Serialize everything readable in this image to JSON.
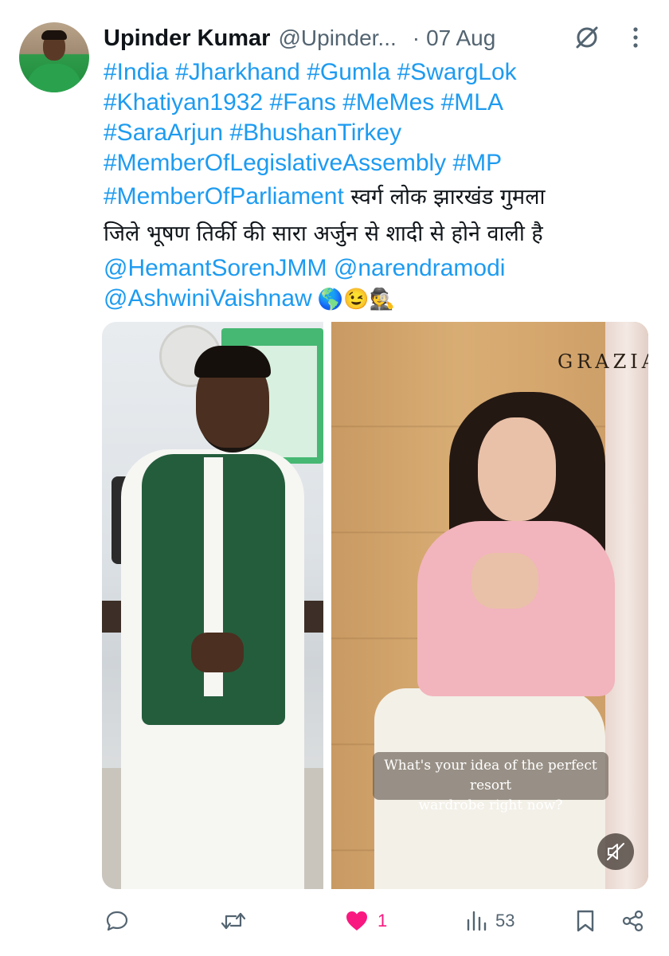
{
  "tweet": {
    "author_name": "Upinder Kumar",
    "author_handle": "@Upinder...",
    "separator": "·",
    "date": "07 Aug",
    "text_lines": [
      {
        "parts": [
          {
            "t": "#India #Jharkhand #Gumla #SwargLok",
            "link": true
          }
        ]
      },
      {
        "parts": [
          {
            "t": "#Khatiyan1932 #Fans #MeMes #MLA",
            "link": true
          }
        ]
      },
      {
        "parts": [
          {
            "t": "#SaraArjun #BhushanTirkey",
            "link": true
          }
        ]
      },
      {
        "parts": [
          {
            "t": "#MemberOfLegislativeAssembly #MP",
            "link": true
          }
        ]
      },
      {
        "parts": [
          {
            "t": "#MemberOfParliament",
            "link": true
          },
          {
            "t": " स्वर्ग लोक झारखंड गुमला",
            "link": false
          }
        ]
      },
      {
        "parts": [
          {
            "t": "जिले भूषण तिर्की की सारा अर्जुन से शादी से होने वाली है",
            "link": false
          }
        ]
      },
      {
        "parts": [
          {
            "t": "@HemantSorenJMM @narendramodi",
            "link": true
          }
        ]
      },
      {
        "parts": [
          {
            "t": "@AshwiniVaishnaw",
            "link": true
          },
          {
            "t": " 🌎😉🕵️",
            "link": false
          }
        ]
      }
    ],
    "media": {
      "right_watermark": "GRAZIA",
      "right_caption_line1": "What's your idea of the perfect resort",
      "right_caption_line2": "wardrobe right now?"
    },
    "actions": {
      "reply_count": "",
      "retweet_count": "",
      "like_count": "1",
      "views_count": "53"
    }
  },
  "icons": {
    "grok": "grok-slash-icon",
    "more": "more-vertical-icon",
    "reply": "reply-icon",
    "retweet": "retweet-icon",
    "like": "heart-filled-icon",
    "views": "views-bar-chart-icon",
    "bookmark": "bookmark-icon",
    "share": "share-icon",
    "mute": "muted-speaker-icon"
  },
  "colors": {
    "link": "#1d9bf0",
    "like": "#f91880",
    "secondary_text": "#536471",
    "primary_text": "#0f1419"
  }
}
